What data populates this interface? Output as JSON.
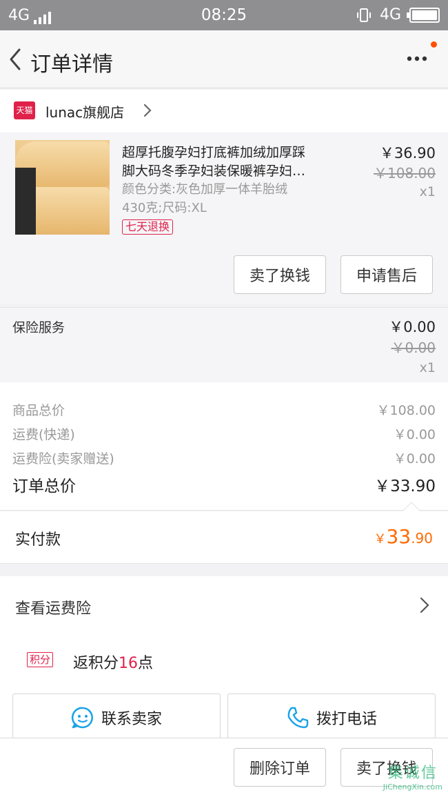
{
  "status_bar": {
    "network_left": "4G",
    "time": "08:25",
    "network_right": "4G"
  },
  "nav": {
    "title": "订单详情"
  },
  "shop": {
    "badge": "天猫",
    "name": "lunac旗舰店"
  },
  "product": {
    "title_line1": "超厚托腹孕妇打底裤加绒加厚踩",
    "title_line2": "脚大码冬季孕妇装保暖裤孕妇…",
    "spec_line1": "颜色分类:灰色加厚一体羊胎绒",
    "spec_line2": "430克;尺码:XL",
    "tag": "七天退换",
    "price": "￥36.90",
    "original_price": "￥108.00",
    "quantity": "x1",
    "buttons": {
      "sell": "卖了换钱",
      "after_sale": "申请售后"
    }
  },
  "insurance": {
    "label": "保险服务",
    "price": "￥0.00",
    "original_price": "￥0.00",
    "quantity": "x1"
  },
  "summary": {
    "goods_total_label": "商品总价",
    "goods_total": "￥108.00",
    "shipping_label": "运费(快递)",
    "shipping": "￥0.00",
    "shipping_insurance_label": "运费险(卖家赠送)",
    "shipping_insurance": "￥0.00",
    "order_total_label": "订单总价",
    "order_total": "￥33.90"
  },
  "payment": {
    "label": "实付款",
    "currency": "￥",
    "integer": "33",
    "decimal": ".90"
  },
  "freight_insurance": {
    "label": "查看运费险"
  },
  "points": {
    "badge": "积分",
    "text_prefix": "返积分",
    "value": "16",
    "text_suffix": "点"
  },
  "contact": {
    "seller": "联系卖家",
    "phone": "拨打电话"
  },
  "bottom_bar": {
    "delete": "删除订单",
    "sell": "卖了换钱"
  },
  "watermark": {
    "text": "集诚信",
    "url": "JiChengXin.com"
  },
  "colors": {
    "accent_orange": "#ff6a00",
    "tmall_red": "#e0214a",
    "icon_blue": "#1aa3e8"
  }
}
